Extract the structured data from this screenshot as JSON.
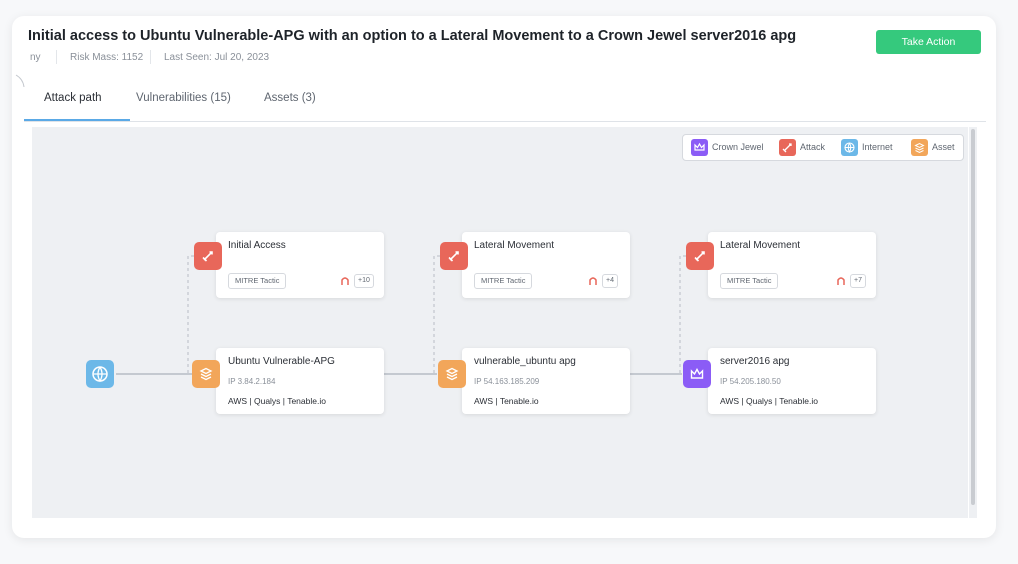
{
  "header": {
    "title": "Initial access to Ubuntu Vulnerable-APG with an option to a Lateral Movement to a Crown Jewel server2016 apg",
    "meta_prefix": "ny",
    "risk_mass": "Risk Mass: 1152",
    "last_seen": "Last Seen: Jul 20, 2023",
    "take_action_label": "Take Action"
  },
  "tabs": [
    {
      "label": "Attack path",
      "active": true
    },
    {
      "label": "Vulnerabilities (15)",
      "active": false
    },
    {
      "label": "Assets (3)",
      "active": false
    }
  ],
  "legend": [
    {
      "label": "Crown Jewel",
      "icon": "crown-icon",
      "color": "#8b5cf6"
    },
    {
      "label": "Attack",
      "icon": "sword-icon",
      "color": "#e8675a"
    },
    {
      "label": "Internet",
      "icon": "globe-icon",
      "color": "#6cb8e8"
    },
    {
      "label": "Asset",
      "icon": "asset-icon",
      "color": "#f2a65a"
    }
  ],
  "graph": {
    "internet_node": {
      "icon": "globe-icon"
    },
    "attack_nodes": [
      {
        "title": "Initial Access",
        "tag": "MITRE Tactic",
        "count": "+10"
      },
      {
        "title": "Lateral Movement",
        "tag": "MITRE Tactic",
        "count": "+4"
      },
      {
        "title": "Lateral Movement",
        "tag": "MITRE Tactic",
        "count": "+7"
      }
    ],
    "asset_nodes": [
      {
        "title": "Ubuntu Vulnerable-APG",
        "ip": "IP 3.84.2.184",
        "sources": "AWS | Qualys | Tenable.io",
        "kind": "asset"
      },
      {
        "title": "vulnerable_ubuntu apg",
        "ip": "IP 54.163.185.209",
        "sources": "AWS | Tenable.io",
        "kind": "asset"
      },
      {
        "title": "server2016 apg",
        "ip": "IP 54.205.180.50",
        "sources": "AWS | Qualys | Tenable.io",
        "kind": "crown-jewel"
      }
    ]
  },
  "colors": {
    "accent": "#5aa9e6",
    "take_action": "#35c97d",
    "attack": "#e8675a",
    "asset": "#f2a65a",
    "crown_jewel": "#8b5cf6",
    "internet": "#6cb8e8"
  }
}
